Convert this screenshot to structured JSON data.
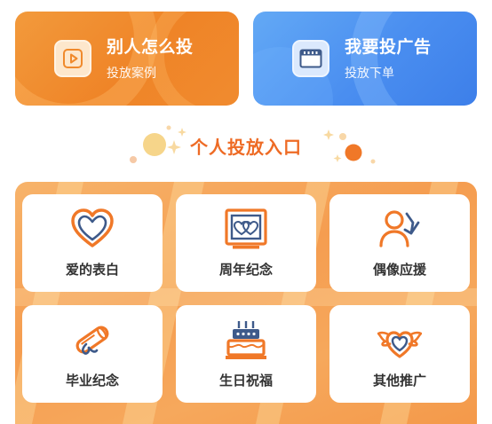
{
  "top_cards": [
    {
      "title": "别人怎么投",
      "subtitle": "投放案例",
      "icon": "play-icon"
    },
    {
      "title": "我要投广告",
      "subtitle": "投放下单",
      "icon": "film-icon"
    }
  ],
  "section": {
    "title": "个人投放入口"
  },
  "grid": [
    {
      "label": "爱的表白",
      "icon": "heart-icon"
    },
    {
      "label": "周年纪念",
      "icon": "heart-frame-icon"
    },
    {
      "label": "偶像应援",
      "icon": "idol-support-icon"
    },
    {
      "label": "毕业纪念",
      "icon": "diploma-icon"
    },
    {
      "label": "生日祝福",
      "icon": "birthday-cake-icon"
    },
    {
      "label": "其他推广",
      "icon": "winged-heart-icon"
    }
  ],
  "colors": {
    "accent_orange": "#ee6b25",
    "card_orange": "#ef8427",
    "card_blue": "#4a8ef0",
    "icon_navy": "#3e5a8a"
  }
}
